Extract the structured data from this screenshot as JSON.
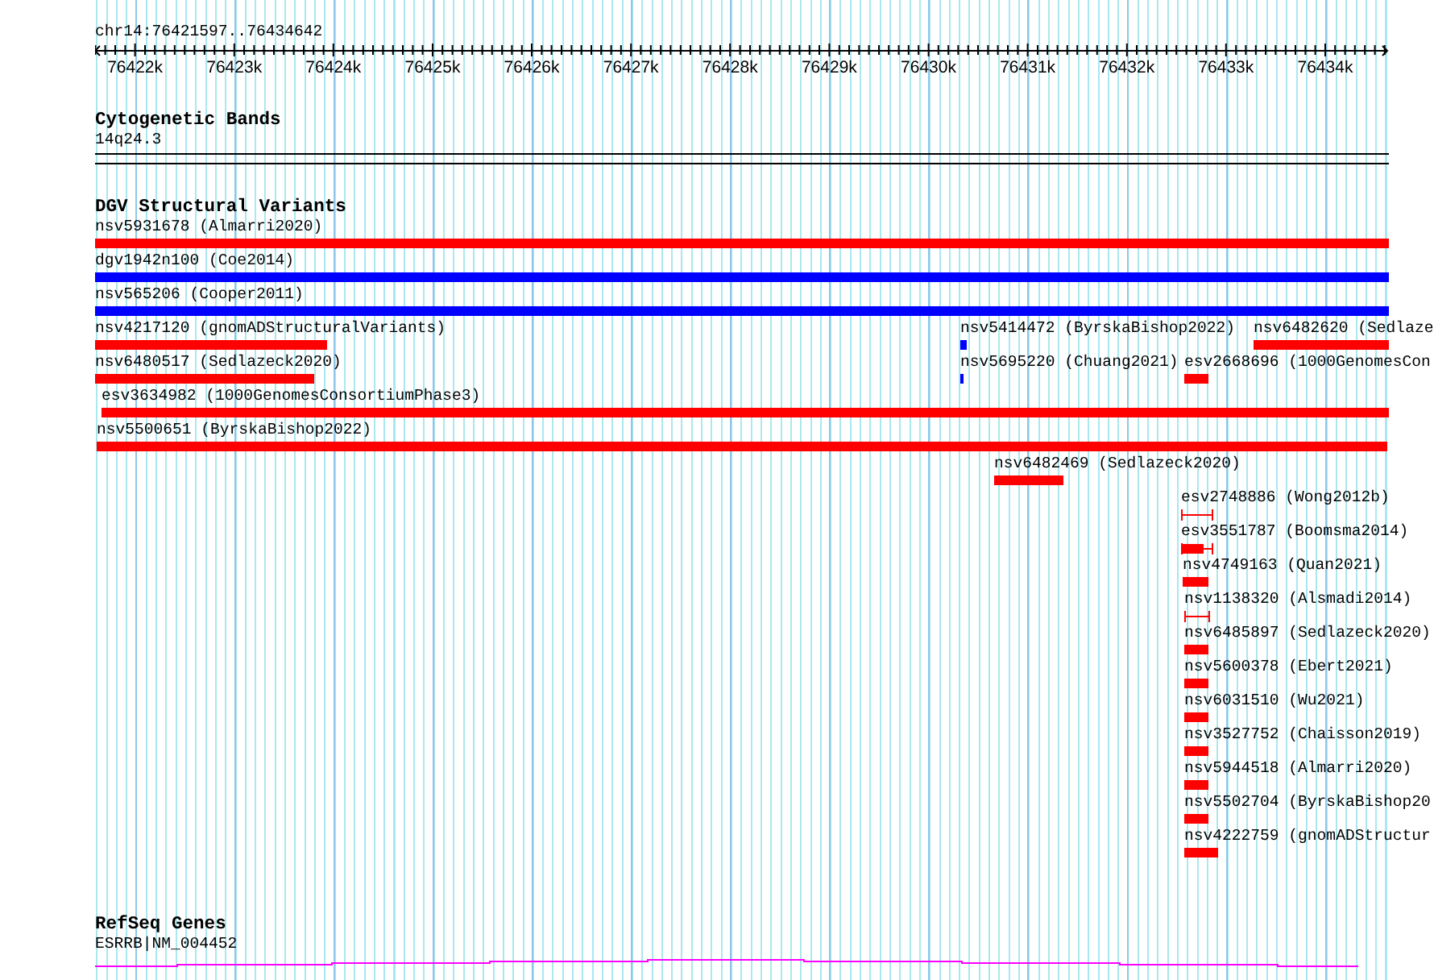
{
  "location": "chr14:76421597..76434642",
  "ruler": {
    "tick_labels": [
      "76422k",
      "76423k",
      "76424k",
      "76425k",
      "76426k",
      "76427k",
      "76428k",
      "76429k",
      "76430k",
      "76431k",
      "76432k",
      "76433k",
      "76434k"
    ]
  },
  "cytogenetic_bands": {
    "title": "Cytogenetic Bands",
    "label": "14q24.3"
  },
  "dgv_structural_variants": {
    "title": "DGV Structural Variants",
    "rows": [
      [
        {
          "label": "nsv5931678 (Almarri2020)",
          "color": "#ff0000",
          "kind": "bar"
        }
      ],
      [
        {
          "label": "dgv1942n100 (Coe2014)",
          "color": "#0000ff",
          "kind": "bar"
        }
      ],
      [
        {
          "label": "nsv565206 (Cooper2011)",
          "color": "#0000ff",
          "kind": "bar"
        }
      ],
      [
        {
          "label": "nsv4217120 (gnomADStructuralVariants)",
          "color": "#ff0000",
          "kind": "bar"
        },
        {
          "label": "nsv5414472 (ByrskaBishop2022)",
          "color": "#0000ff",
          "kind": "bar"
        },
        {
          "label": "nsv6482620 (Sedlaze",
          "color": "#ff0000",
          "kind": "bar"
        }
      ],
      [
        {
          "label": "nsv6480517 (Sedlazeck2020)",
          "color": "#ff0000",
          "kind": "bar"
        },
        {
          "label": "nsv5695220 (Chuang2021)",
          "color": "#0000ff",
          "kind": "bar"
        },
        {
          "label": "esv2668696 (1000GenomesCon",
          "color": "#ff0000",
          "kind": "bar"
        }
      ],
      [
        {
          "label": "esv3634982 (1000GenomesConsortiumPhase3)",
          "color": "#ff0000",
          "kind": "bar"
        }
      ],
      [
        {
          "label": "nsv5500651 (ByrskaBishop2022)",
          "color": "#ff0000",
          "kind": "bar"
        }
      ],
      [
        {
          "label": "nsv6482469 (Sedlazeck2020)",
          "color": "#ff0000",
          "kind": "bar"
        }
      ],
      [
        {
          "label": "esv2748886 (Wong2012b)",
          "color": "#ff0000",
          "kind": "interval"
        }
      ],
      [
        {
          "label": "esv3551787 (Boomsma2014)",
          "color": "#ff0000",
          "kind": "bar-interval"
        }
      ],
      [
        {
          "label": "nsv4749163 (Quan2021)",
          "color": "#ff0000",
          "kind": "bar"
        }
      ],
      [
        {
          "label": "nsv1138320 (Alsmadi2014)",
          "color": "#ff0000",
          "kind": "interval"
        }
      ],
      [
        {
          "label": "nsv6485897 (Sedlazeck2020)",
          "color": "#ff0000",
          "kind": "bar"
        }
      ],
      [
        {
          "label": "nsv5600378 (Ebert2021)",
          "color": "#ff0000",
          "kind": "bar"
        }
      ],
      [
        {
          "label": "nsv6031510 (Wu2021)",
          "color": "#ff0000",
          "kind": "bar"
        }
      ],
      [
        {
          "label": "nsv3527752 (Chaisson2019)",
          "color": "#ff0000",
          "kind": "bar"
        }
      ],
      [
        {
          "label": "nsv5944518 (Almarri2020)",
          "color": "#ff0000",
          "kind": "bar"
        }
      ],
      [
        {
          "label": "nsv5502704 (ByrskaBishop20",
          "color": "#ff0000",
          "kind": "bar"
        }
      ],
      [
        {
          "label": "nsv4222759 (gnomADStructur",
          "color": "#ff0000",
          "kind": "bar"
        }
      ]
    ]
  },
  "refseq_genes": {
    "title": "RefSeq Genes",
    "label": "ESRRB|NM_004452"
  }
}
